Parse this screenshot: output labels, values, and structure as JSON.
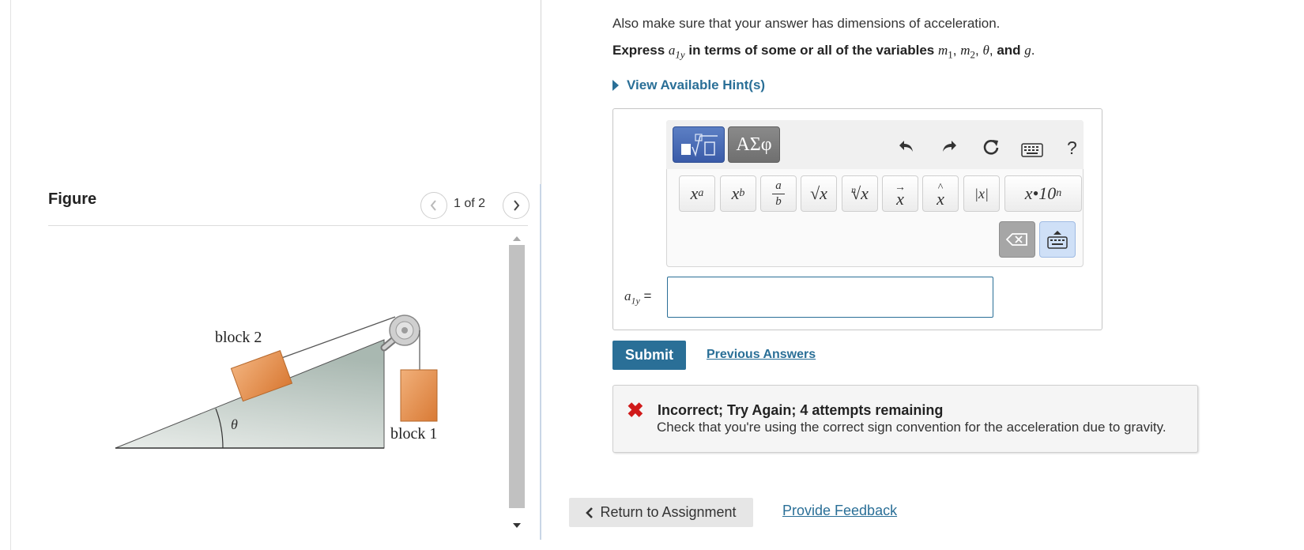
{
  "figure": {
    "title": "Figure",
    "page_indicator": "1 of 2",
    "block2_label": "block 2",
    "block1_label": "block 1",
    "angle_label": "θ"
  },
  "question": {
    "instruction": "Also make sure that your answer has dimensions of acceleration.",
    "express_prefix": "Express",
    "express_var": "a",
    "express_var_sub": "1y",
    "express_middle": "in terms of some or all of the variables",
    "var_m": "m",
    "var_m1_sub": "1",
    "var_m2_sub": "2",
    "var_theta": "θ",
    "express_and": "and",
    "var_g": "g",
    "comma": ",",
    "period": ".",
    "hints_label": "View Available Hint(s)"
  },
  "toolbar": {
    "symbols_label": "ΑΣφ",
    "help_label": "?",
    "keys": {
      "superscript": "x",
      "superscript_exp": "a",
      "subscript": "x",
      "subscript_sub": "b",
      "fraction_num": "a",
      "fraction_den": "b",
      "sqrt": "√x",
      "nthroot_index": "n",
      "nthroot": "√x",
      "vector": "x",
      "vector_mark": "→",
      "unit_vector": "x",
      "unit_vector_mark": "^",
      "abs": "|x|",
      "sci": "x•10",
      "sci_exp": "n"
    }
  },
  "answer": {
    "label_var": "a",
    "label_sub": "1y",
    "label_eq": " =",
    "value": ""
  },
  "actions": {
    "submit_label": "Submit",
    "previous_answers_label": "Previous Answers"
  },
  "feedback": {
    "title": "Incorrect; Try Again; 4 attempts remaining",
    "message": "Check that you're using the correct sign convention for the acceleration due to gravity."
  },
  "footer": {
    "return_label": "Return to Assignment",
    "feedback_link": "Provide Feedback"
  },
  "colors": {
    "accent": "#2a6f97",
    "error": "#d01a1a",
    "block": "#e8954f",
    "incline": "#c5d1cc"
  },
  "icons": {
    "prev": "chevron-left-icon",
    "next": "chevron-right-icon",
    "hints": "caret-right-icon",
    "undo": "undo-icon",
    "redo": "redo-icon",
    "reset": "reset-icon",
    "keyboard": "keyboard-icon",
    "backspace": "backspace-icon",
    "error": "x-mark-icon",
    "back": "chevron-left-icon"
  }
}
